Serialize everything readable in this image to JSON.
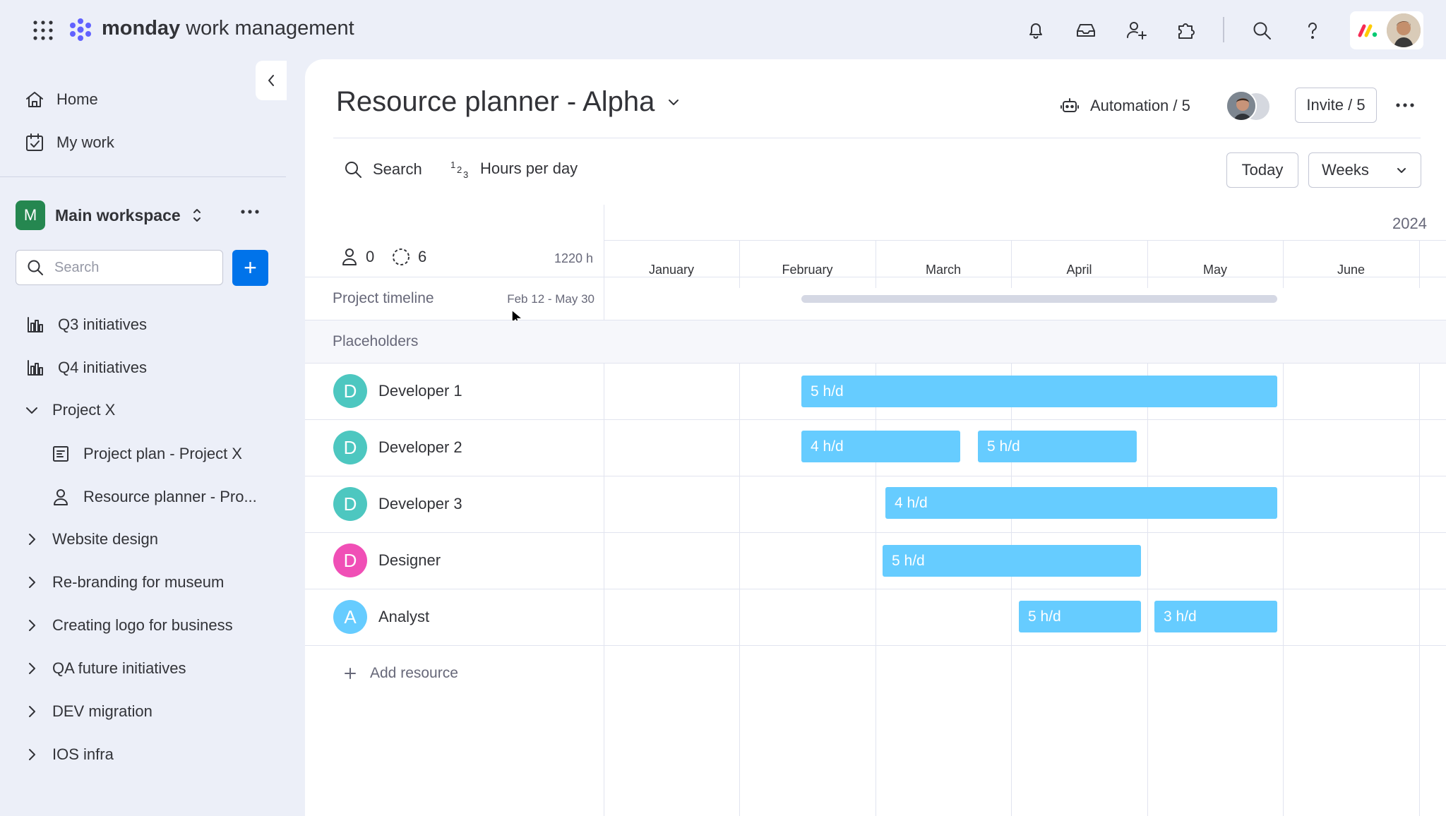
{
  "app": {
    "brand_bold": "monday",
    "brand_light": "work management",
    "header_icons": [
      "grid-icon",
      "bell-icon",
      "inbox-icon",
      "add-user-icon",
      "puzzle-icon",
      "search-icon",
      "help-icon"
    ]
  },
  "sidebar": {
    "home": "Home",
    "my_work": "My work",
    "workspace": {
      "initial": "M",
      "name": "Main workspace",
      "color": "#258750"
    },
    "search_placeholder": "Search",
    "add_button": "+",
    "items": [
      {
        "label": "Q3 initiatives",
        "icon": "board-chart-icon"
      },
      {
        "label": "Q4 initiatives",
        "icon": "board-chart-icon"
      },
      {
        "label": "Project X",
        "icon": "chevron-down-icon"
      },
      {
        "label": "Project plan - Project X",
        "icon": "doc-board-icon"
      },
      {
        "label": "Resource planner - Pro...",
        "icon": "person-icon"
      },
      {
        "label": "Website design",
        "icon": "chevron-right-icon"
      },
      {
        "label": "Re-branding for museum",
        "icon": "chevron-right-icon"
      },
      {
        "label": "Creating logo for business",
        "icon": "chevron-right-icon"
      },
      {
        "label": "QA future initiatives",
        "icon": "chevron-right-icon"
      },
      {
        "label": "DEV migration",
        "icon": "chevron-right-icon"
      },
      {
        "label": "IOS infra",
        "icon": "chevron-right-icon"
      }
    ]
  },
  "board": {
    "title": "Resource planner - Alpha",
    "automation": "Automation / 5",
    "invite": "Invite / 5",
    "search": "Search",
    "hours_per_day": "Hours per day",
    "hours_icon_text": "123",
    "today": "Today",
    "view": "Weeks",
    "year": "2024",
    "assigned_count": "0",
    "placeholder_count": "6",
    "total_hours": "1220 h",
    "months": [
      "January",
      "February",
      "March",
      "April",
      "May",
      "June"
    ],
    "project_timeline_label": "Project timeline",
    "project_timeline_range": "Feb 12 - May 30",
    "placeholders_label": "Placeholders",
    "add_resource": "Add resource",
    "resources": [
      {
        "initial": "D",
        "name": "Developer 1",
        "color": "#4dc7c0",
        "bars": [
          {
            "label": "5 h/d"
          }
        ]
      },
      {
        "initial": "D",
        "name": "Developer 2",
        "color": "#4dc7c0",
        "bars": [
          {
            "label": "4 h/d"
          },
          {
            "label": "5 h/d"
          }
        ]
      },
      {
        "initial": "D",
        "name": "Developer 3",
        "color": "#4dc7c0",
        "bars": [
          {
            "label": "4 h/d"
          }
        ]
      },
      {
        "initial": "D",
        "name": "Designer",
        "color": "#f04fb6",
        "bars": [
          {
            "label": "5 h/d"
          }
        ]
      },
      {
        "initial": "A",
        "name": "Analyst",
        "color": "#66ccff",
        "bars": [
          {
            "label": "5 h/d"
          },
          {
            "label": "3 h/d"
          }
        ]
      }
    ],
    "bar_color": "#66ccff",
    "accent_color": "#0073ea"
  }
}
